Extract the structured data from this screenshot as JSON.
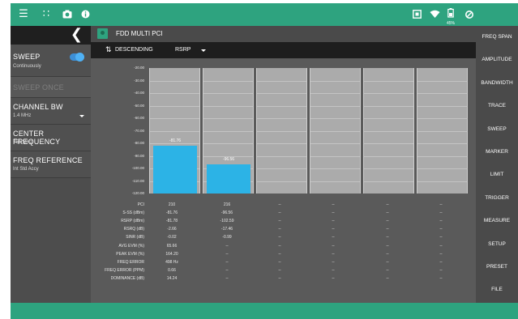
{
  "topbar": {
    "icons": [
      "menu-icon",
      "grid-icon",
      "camera-icon",
      "info-icon",
      "screen-icon",
      "wifi-icon",
      "battery-icon",
      "settings-icon"
    ],
    "battery_text": "45%",
    "accent": "#2ea37f"
  },
  "leftpanel": {
    "back_icon": "chevron-left-icon",
    "sweep": {
      "title": "SWEEP",
      "sub": "Continuously",
      "toggle_on": true
    },
    "sweep_once": {
      "title": "SWEEP ONCE"
    },
    "channel_bw": {
      "title": "CHANNEL BW",
      "value": "1.4 MHz"
    },
    "center_freq": {
      "title": "CENTER FREQUENCY",
      "value": "751 MHz"
    },
    "freq_ref": {
      "title": "FREQ REFERENCE",
      "value": "Int Std Accy"
    }
  },
  "main": {
    "title": "FDD MULTI PCI",
    "sort": {
      "order": "DESCENDING",
      "metric": "RSRP"
    }
  },
  "chart_data": {
    "type": "bar",
    "ylim": [
      -120,
      -20
    ],
    "yticks": [
      "-20.00",
      "-30.00",
      "-40.00",
      "-50.00",
      "-60.00",
      "-70.00",
      "-80.00",
      "-90.00",
      "-100.00",
      "-110.00",
      "-120.00"
    ],
    "categories": [
      "210",
      "216",
      "",
      "",
      "",
      ""
    ],
    "values": [
      -81.76,
      -96.56,
      null,
      null,
      null,
      null
    ],
    "value_labels": [
      "-81.76",
      "-96.56",
      "",
      "",
      "",
      ""
    ],
    "bar_color": "#2cb3e6"
  },
  "table": {
    "row_labels": [
      "PCI",
      "S-SS (dBm)",
      "RSRP (dBm)",
      "RSRQ (dB)",
      "SINR (dB)",
      "AVG EVM (%)",
      "PEAK EVM (%)",
      "FREQ ERROR",
      "FREQ ERROR (PPM)",
      "DOMINANCE (dB)"
    ],
    "columns": [
      [
        "210",
        "-81.76",
        "-81.78",
        "-2.66",
        "-0.02",
        "65.66",
        "164.20",
        "498 Hz",
        "0.66",
        "14.24"
      ],
      [
        "216",
        "-96.56",
        "-102.59",
        "-17.46",
        "-0.99",
        "--",
        "--",
        "--",
        "--",
        "--"
      ],
      [
        "--",
        "--",
        "--",
        "--",
        "--",
        "--",
        "--",
        "--",
        "--",
        "--"
      ],
      [
        "--",
        "--",
        "--",
        "--",
        "--",
        "--",
        "--",
        "--",
        "--",
        "--"
      ],
      [
        "--",
        "--",
        "--",
        "--",
        "--",
        "--",
        "--",
        "--",
        "--",
        "--"
      ],
      [
        "--",
        "--",
        "--",
        "--",
        "--",
        "--",
        "--",
        "--",
        "--",
        "--"
      ]
    ]
  },
  "rightpanel": {
    "items": [
      "FREQ SPAN",
      "AMPLITUDE",
      "BANDWIDTH",
      "TRACE",
      "SWEEP",
      "MARKER",
      "LIMIT",
      "TRIGGER",
      "MEASURE",
      "SETUP",
      "PRESET",
      "FILE"
    ]
  }
}
